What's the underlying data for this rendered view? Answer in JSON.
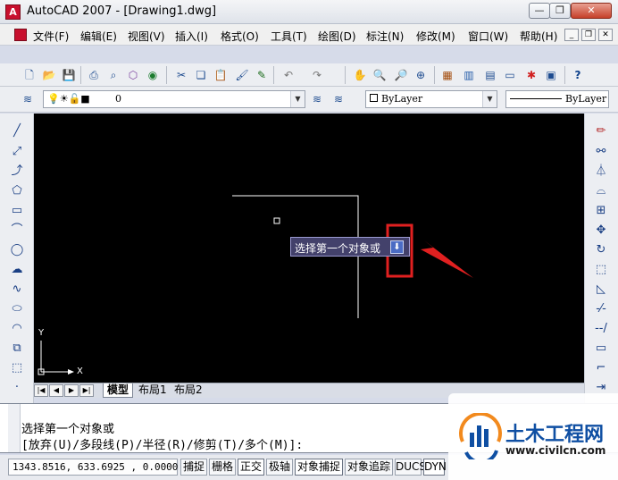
{
  "window": {
    "title": "AutoCAD 2007 - [Drawing1.dwg]",
    "app_icon": "autocad-logo-icon",
    "controls": [
      "minimize-icon",
      "restore-icon",
      "close-icon"
    ]
  },
  "menu": {
    "items": [
      "文件(F)",
      "编辑(E)",
      "视图(V)",
      "插入(I)",
      "格式(O)",
      "工具(T)",
      "绘图(D)",
      "标注(N)",
      "修改(M)",
      "窗口(W)",
      "帮助(H)"
    ],
    "mdi_controls": [
      "minimize-icon",
      "restore-icon",
      "close-icon"
    ]
  },
  "standard_toolbar": {
    "icons": [
      "new-icon",
      "open-icon",
      "save-icon",
      "print-icon",
      "print-preview-icon",
      "publish-icon",
      "plot-icon",
      "cut-icon",
      "copy-icon",
      "paste-icon",
      "match-properties-icon",
      "block-editor-icon",
      "undo-icon",
      "redo-icon",
      "pan-icon",
      "zoom-realtime-icon",
      "zoom-window-icon",
      "zoom-previous-icon",
      "properties-icon",
      "design-center-icon",
      "tool-palettes-icon",
      "sheet-set-icon",
      "markup-icon",
      "calculator-icon",
      "help-icon"
    ]
  },
  "layers_toolbar": {
    "layer_value": "0",
    "color_value": "ByLayer",
    "linetype_value": "ByLayer",
    "icons": [
      "layer-manager-icon",
      "layer-previous-icon",
      "make-current-icon"
    ]
  },
  "draw_toolbar": {
    "icons": [
      "line-icon",
      "construction-line-icon",
      "polyline-icon",
      "polygon-icon",
      "rectangle-icon",
      "arc-icon",
      "circle-icon",
      "revision-cloud-icon",
      "spline-icon",
      "ellipse-icon",
      "ellipse-arc-icon",
      "insert-block-icon",
      "make-block-icon",
      "point-icon"
    ]
  },
  "modify_toolbar": {
    "icons": [
      "erase-icon",
      "copy-object-icon",
      "mirror-icon",
      "offset-icon",
      "array-icon",
      "move-icon",
      "rotate-icon",
      "scale-icon",
      "stretch-icon",
      "trim-icon",
      "extend-icon",
      "break-icon",
      "join-icon",
      "chamfer-icon"
    ]
  },
  "drawing": {
    "background": "#000000",
    "axis_x_label": "X",
    "axis_y_label": "Y",
    "tooltip_text": "选择第一个对象或",
    "tooltip_button_icon": "download-arrow-icon",
    "highlight_color": "#e02020"
  },
  "tabs": {
    "nav": [
      "first-tab-icon",
      "prev-tab-icon",
      "next-tab-icon",
      "last-tab-icon"
    ],
    "items": [
      "模型",
      "布局1",
      "布局2"
    ],
    "active": "模型"
  },
  "command": {
    "line1": "选择第一个对象或",
    "line2": "[放弃(U)/多段线(P)/半径(R)/修剪(T)/多个(M)]:"
  },
  "status": {
    "coords": "1343.8516, 633.6925 , 0.0000",
    "buttons": [
      "捕捉",
      "栅格",
      "正交",
      "极轴",
      "对象捕捉",
      "对象追踪",
      "DUCS",
      "DYN"
    ]
  },
  "watermark": {
    "title": "土木工程网",
    "url": "www.civilcn.com",
    "logo_icon": "civilcn-logo-icon"
  }
}
